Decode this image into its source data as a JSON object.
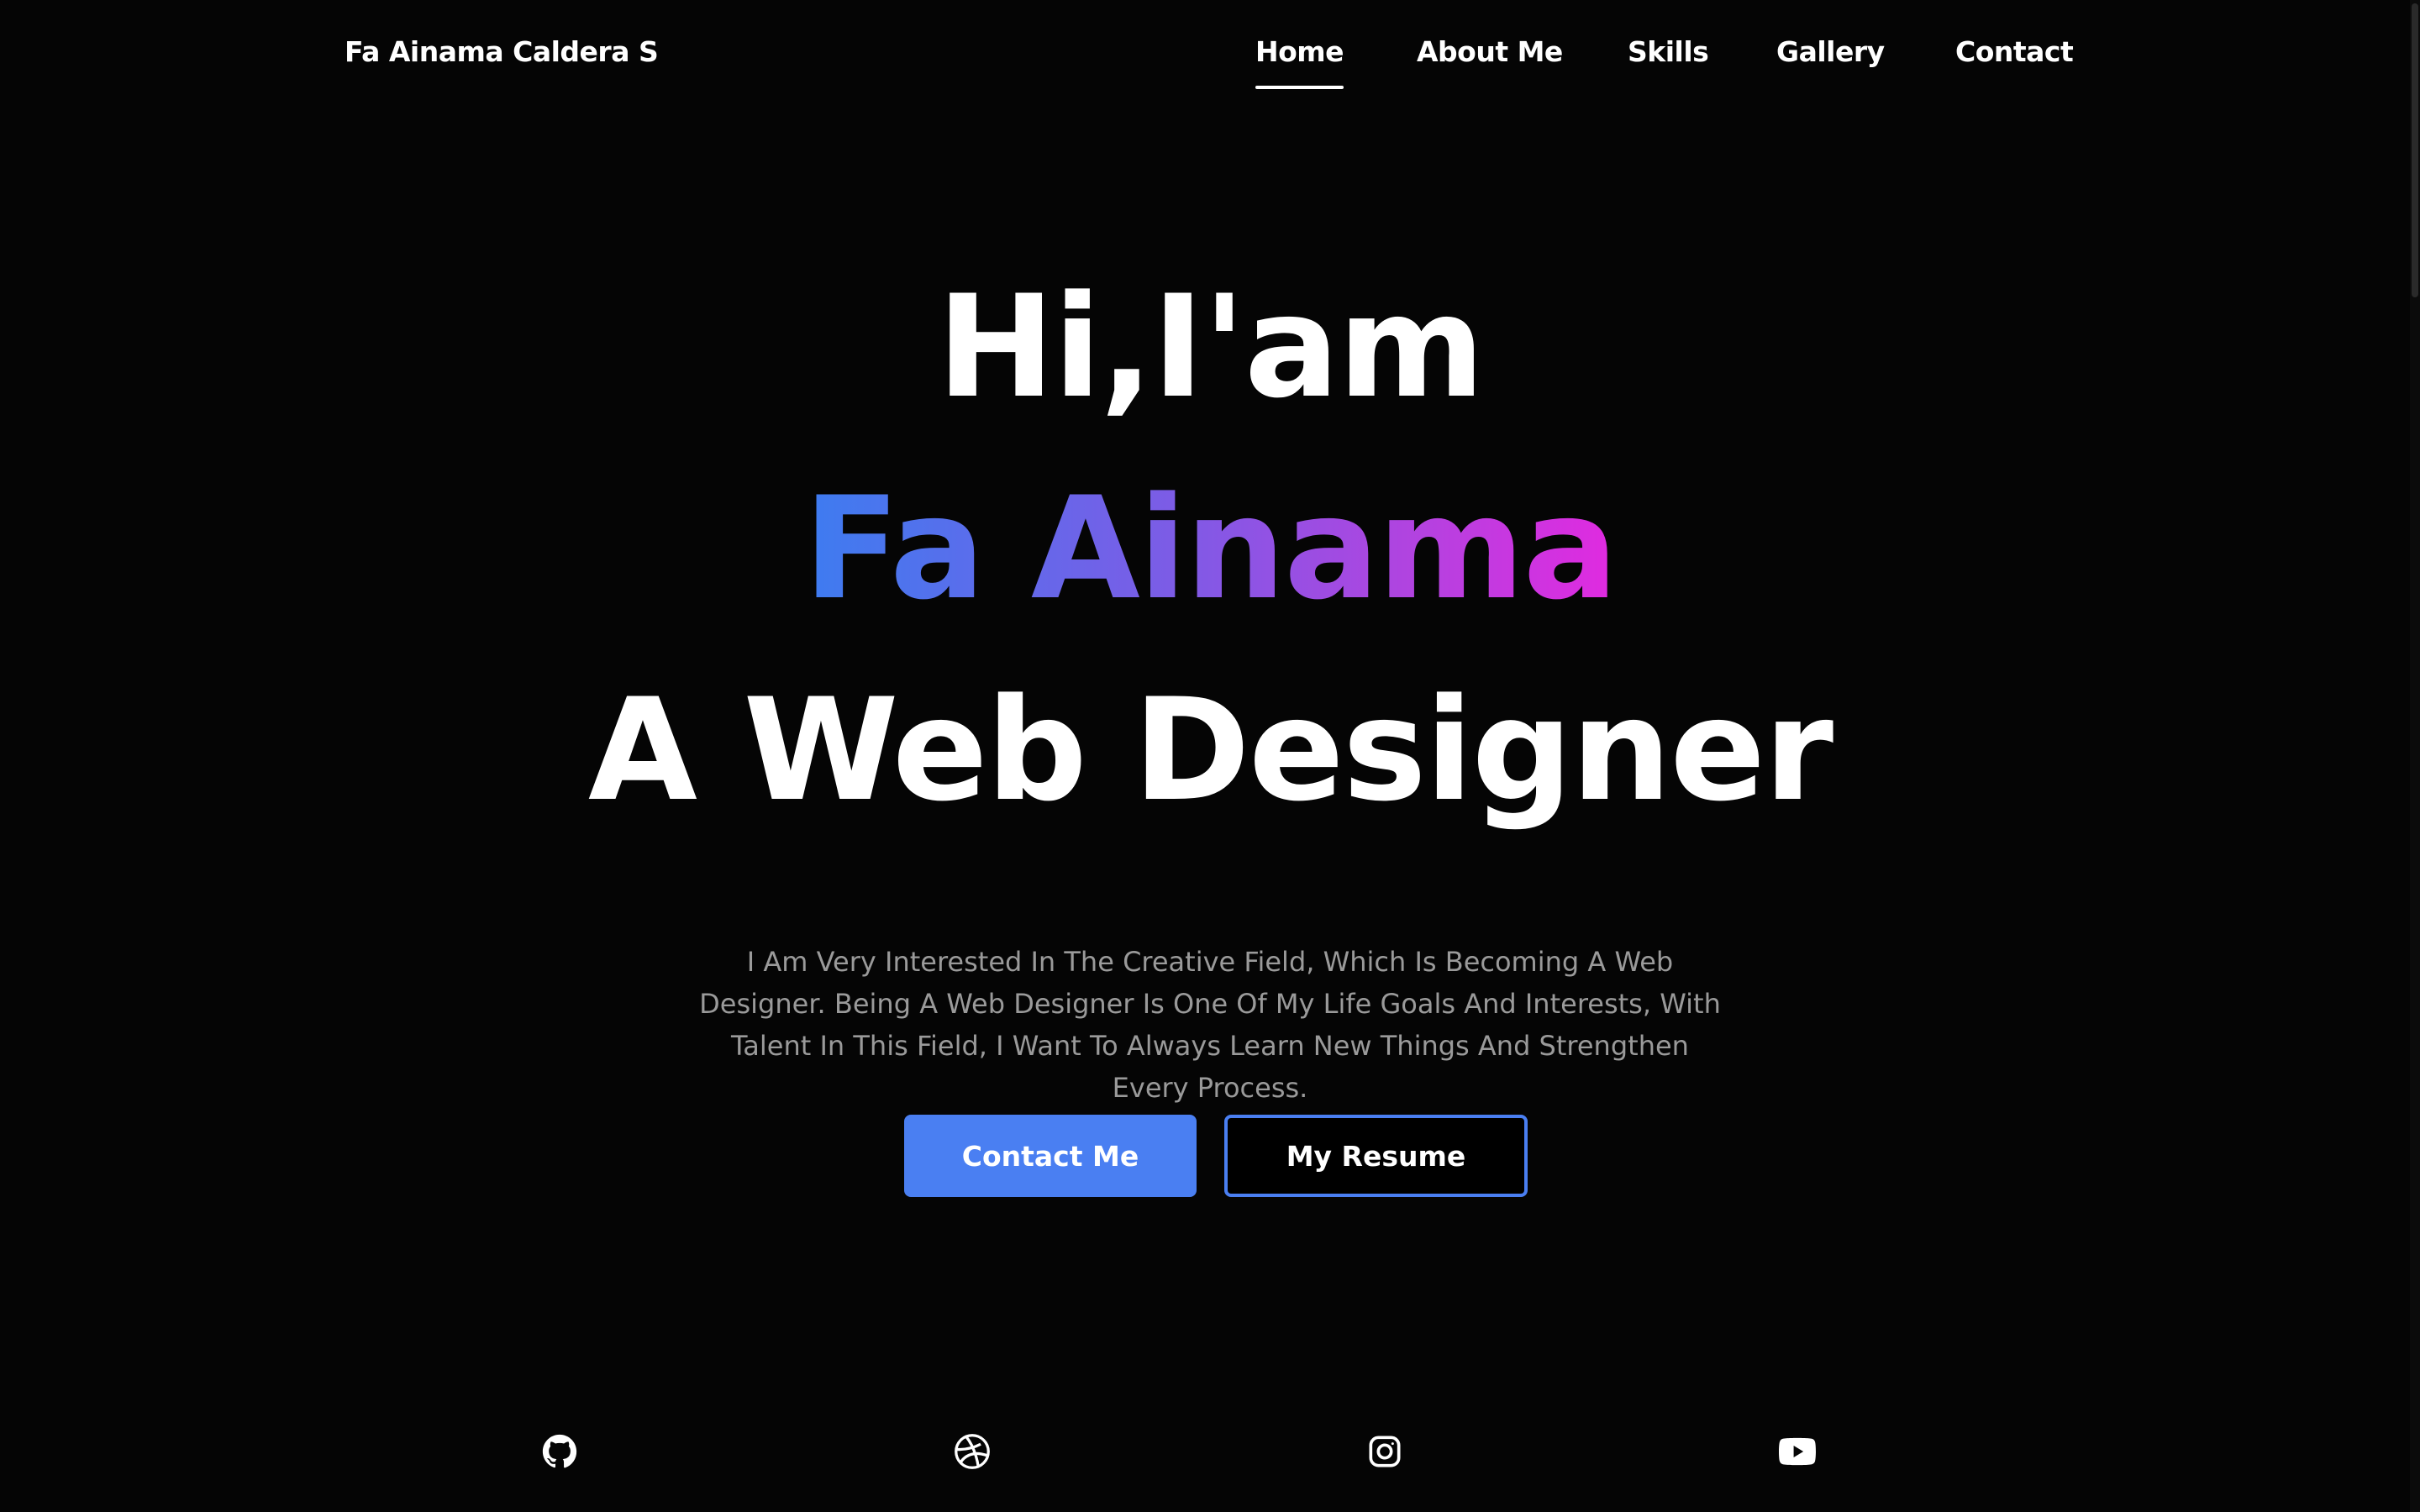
{
  "header": {
    "brand": "Fa Ainama Caldera S",
    "nav": [
      {
        "label": "Home",
        "active": true
      },
      {
        "label": "About Me",
        "active": false
      },
      {
        "label": "Skills",
        "active": false
      },
      {
        "label": "Gallery",
        "active": false
      },
      {
        "label": "Contact",
        "active": false
      }
    ]
  },
  "hero": {
    "greeting": "Hi,I'am",
    "name": "Fa Ainama",
    "role": "A Web Designer",
    "description": "I Am Very Interested In The Creative Field, Which Is Becoming A Web Designer. Being A Web Designer Is One Of My Life Goals And Interests, With Talent In This Field, I Want To Always Learn New Things And Strengthen Every Process.",
    "buttons": {
      "contact_label": "Contact Me",
      "resume_label": "My Resume"
    }
  },
  "social": [
    {
      "icon": "github-icon"
    },
    {
      "icon": "dribbble-icon"
    },
    {
      "icon": "instagram-icon"
    },
    {
      "icon": "youtube-icon"
    }
  ],
  "colors": {
    "background": "#050505",
    "accent": "#4a7ff2",
    "gradient_start": "#3d7cf0",
    "gradient_end": "#e12ae0",
    "description_text": "#9a9a9a"
  }
}
